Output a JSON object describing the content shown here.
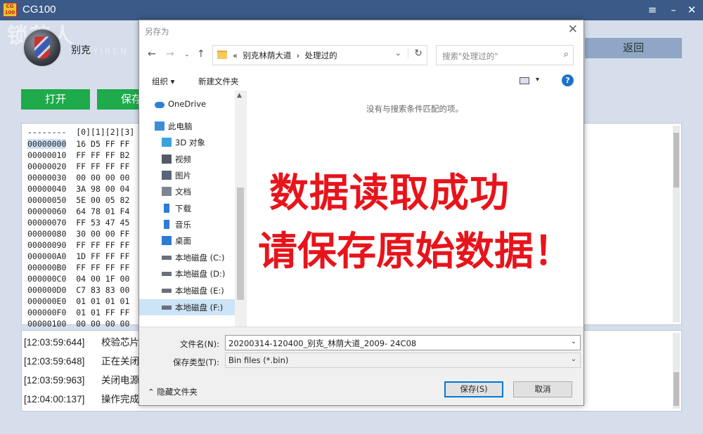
{
  "app": {
    "title": "CG100",
    "logo_text": "CG 100",
    "car_name": "别克",
    "watermark": "锁艺人",
    "watermark_sub": "SUOYIREN",
    "back_button": "返回",
    "open_button": "打开",
    "save_button": "保存"
  },
  "hex": {
    "header": "--------  [0][1][2][3]",
    "rows": [
      {
        "addr": "00000000",
        "bytes": "16 D5 FF FF"
      },
      {
        "addr": "00000010",
        "bytes": "FF FF FF B2"
      },
      {
        "addr": "00000020",
        "bytes": "FF FF FF FF"
      },
      {
        "addr": "00000030",
        "bytes": "00 00 00 00"
      },
      {
        "addr": "00000040",
        "bytes": "3A 98 00 04"
      },
      {
        "addr": "00000050",
        "bytes": "5E 00 05 82"
      },
      {
        "addr": "00000060",
        "bytes": "64 78 01 F4"
      },
      {
        "addr": "00000070",
        "bytes": "FF 53 47 45"
      },
      {
        "addr": "00000080",
        "bytes": "30 00 00 FF"
      },
      {
        "addr": "00000090",
        "bytes": "FF FF FF FF"
      },
      {
        "addr": "000000A0",
        "bytes": "1D FF FF FF"
      },
      {
        "addr": "000000B0",
        "bytes": "FF FF FF FF"
      },
      {
        "addr": "000000C0",
        "bytes": "04 00 1F 00"
      },
      {
        "addr": "000000D0",
        "bytes": "C7 83 83 00"
      },
      {
        "addr": "000000E0",
        "bytes": "01 01 01 01"
      },
      {
        "addr": "000000F0",
        "bytes": "01 01 FF FF"
      },
      {
        "addr": "00000100",
        "bytes": "00 00 00 00"
      }
    ]
  },
  "log": [
    {
      "time": "[12:03:59:644]",
      "msg": "校验芯片"
    },
    {
      "time": "[12:03:59:648]",
      "msg": "正在关闭"
    },
    {
      "time": "[12:03:59:963]",
      "msg": "关闭电源"
    },
    {
      "time": "[12:04:00:137]",
      "msg": "操作完成"
    }
  ],
  "dialog": {
    "title": "另存为",
    "address": "«  别克林荫大道  ›  处理过的",
    "search_placeholder": "搜索\"处理过的\"",
    "organize": "组织 ▾",
    "new_folder": "新建文件夹",
    "help": "?",
    "empty_message": "没有与搜索条件匹配的项。",
    "nav": [
      {
        "label": "OneDrive",
        "icon": "cloud-icon",
        "color": "#2f7fd6"
      },
      {
        "label": "此电脑",
        "icon": "computer-icon",
        "color": "#3c8dd8"
      },
      {
        "label": "3D 对象",
        "icon": "cube-icon",
        "color": "#38a3dd"
      },
      {
        "label": "视频",
        "icon": "video-icon",
        "color": "#555a66"
      },
      {
        "label": "图片",
        "icon": "picture-icon",
        "color": "#5a6577"
      },
      {
        "label": "文档",
        "icon": "document-icon",
        "color": "#7d8591"
      },
      {
        "label": "下载",
        "icon": "download-icon",
        "color": "#2d7bd2"
      },
      {
        "label": "音乐",
        "icon": "music-icon",
        "color": "#2d7bd2"
      },
      {
        "label": "桌面",
        "icon": "desktop-icon",
        "color": "#2d7bd2"
      },
      {
        "label": "本地磁盘 (C:)",
        "icon": "drive-icon",
        "color": "#6b7078"
      },
      {
        "label": "本地磁盘 (D:)",
        "icon": "drive-icon",
        "color": "#6b7078"
      },
      {
        "label": "本地磁盘 (E:)",
        "icon": "drive-icon",
        "color": "#6b7078"
      },
      {
        "label": "本地磁盘 (F:)",
        "icon": "drive-icon",
        "color": "#6b7078"
      }
    ],
    "filename_label": "文件名(N):",
    "filename_value": "20200314-120400_别克_林荫大道_2009- 24C08",
    "filetype_label": "保存类型(T):",
    "filetype_value": "Bin files (*.bin)",
    "hide_folders": "隐藏文件夹",
    "save_button": "保存(S)",
    "cancel_button": "取消"
  },
  "overlay": {
    "line1": "数据读取成功",
    "line2": "请保存原始数据！"
  }
}
